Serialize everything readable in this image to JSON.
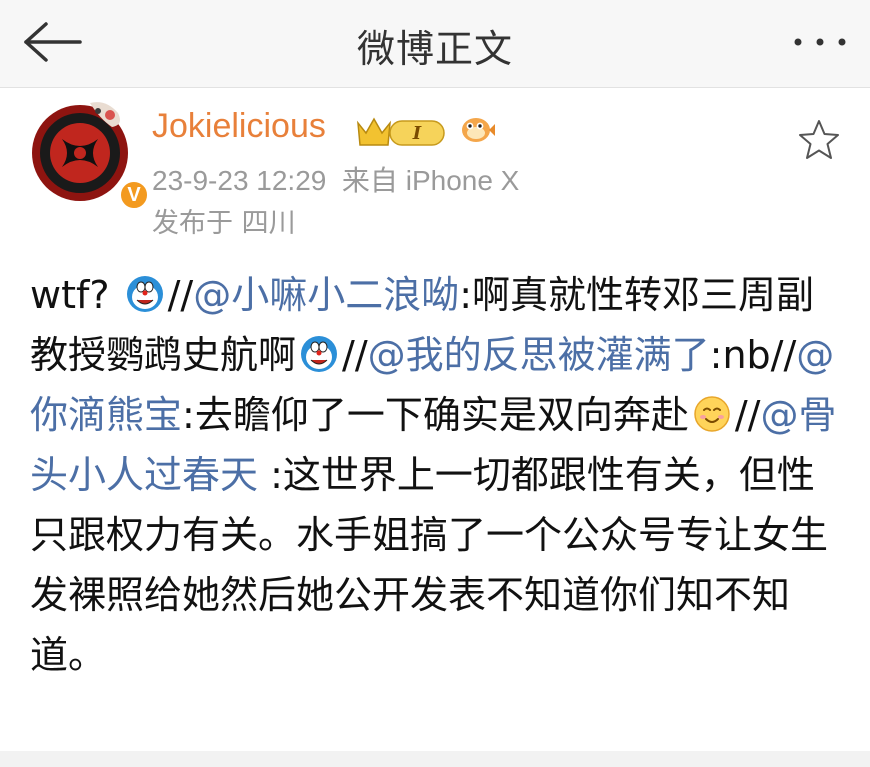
{
  "header": {
    "title": "微博正文"
  },
  "post": {
    "username": "Jokielicious",
    "level_badge": "I",
    "verified_badge": "V",
    "timestamp": "23-9-23 12:29",
    "source_prefix": "来自",
    "source_device": "iPhone X",
    "location": "发布于 四川",
    "content": {
      "t1": "wtf?",
      "s1": "//",
      "m1": "@小嘛小二浪呦",
      "t2": ":啊真就性转邓三周副教授鹦鹉史航啊",
      "s2": "//",
      "m2": "@我的反思被灌满了",
      "t3": ":nb//",
      "m3": "@你滴熊宝",
      "t4": ":去瞻仰了一下确实是双向奔赴",
      "s3": "//",
      "m4": "@骨头小人过春天",
      "t5": " :这世界上一切都跟性有关，但性只跟权力有关。水手姐搞了一个公众号专让女生发裸照给她然后她公开发表不知道你们知不知道。"
    }
  },
  "icons": {
    "back": "back-arrow-icon",
    "more": "more-dots-icon",
    "favorite": "star-outline-icon",
    "crown": "crown-level-icon",
    "fish": "pufferfish-icon",
    "emoji_doraemon": "doraemon-emoji-icon",
    "emoji_smile": "smile-emoji-icon"
  },
  "colors": {
    "username": "#e8803a",
    "mention": "#4c6fa6",
    "meta": "#9a9a9a",
    "verified": "#f39a1f"
  }
}
